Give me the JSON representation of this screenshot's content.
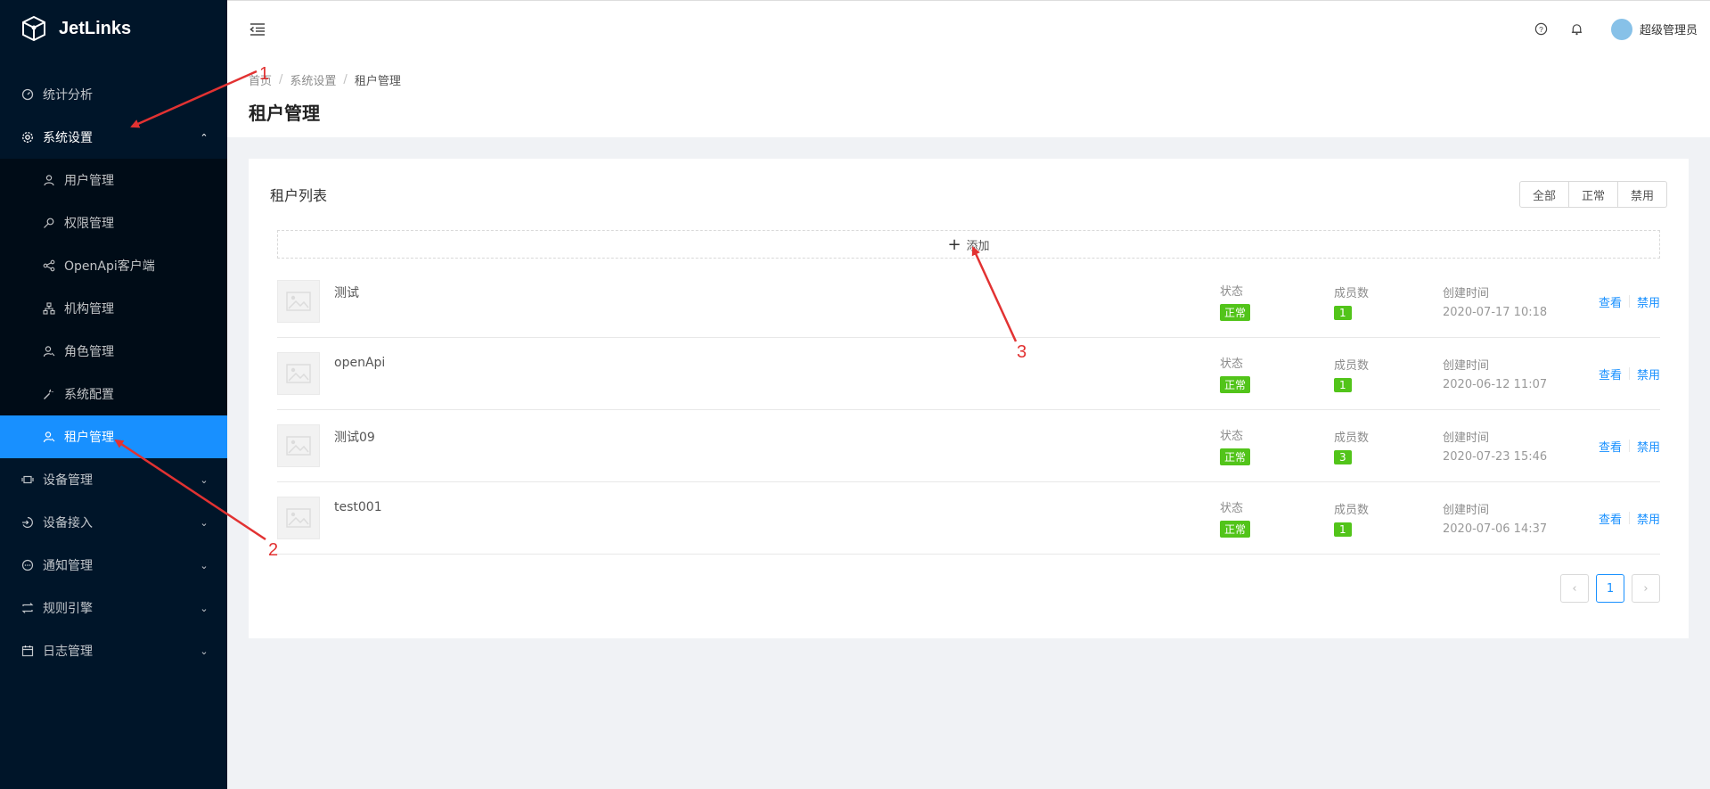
{
  "app": {
    "name": "JetLinks"
  },
  "sidebar": {
    "items": [
      {
        "label": "统计分析",
        "icon": "dashboard-icon"
      },
      {
        "label": "系统设置",
        "icon": "gear-icon",
        "expanded": true,
        "children": [
          {
            "label": "用户管理",
            "icon": "user-icon"
          },
          {
            "label": "权限管理",
            "icon": "key-icon"
          },
          {
            "label": "OpenApi客户端",
            "icon": "share-icon"
          },
          {
            "label": "机构管理",
            "icon": "org-icon"
          },
          {
            "label": "角色管理",
            "icon": "role-icon"
          },
          {
            "label": "系统配置",
            "icon": "wrench-icon"
          },
          {
            "label": "租户管理",
            "icon": "tenant-icon",
            "active": true
          }
        ]
      },
      {
        "label": "设备管理",
        "icon": "device-icon"
      },
      {
        "label": "设备接入",
        "icon": "login-icon"
      },
      {
        "label": "通知管理",
        "icon": "message-icon"
      },
      {
        "label": "规则引擎",
        "icon": "swap-icon"
      },
      {
        "label": "日志管理",
        "icon": "calendar-icon"
      }
    ]
  },
  "header": {
    "user_name": "超级管理员"
  },
  "breadcrumb": [
    "首页",
    "系统设置",
    "租户管理"
  ],
  "page_title": "租户管理",
  "card": {
    "title": "租户列表",
    "filters": [
      "全部",
      "正常",
      "禁用"
    ],
    "add_label": "添加"
  },
  "columns": {
    "status": "状态",
    "members": "成员数",
    "created": "创建时间"
  },
  "tenants": [
    {
      "name": "测试",
      "status": "正常",
      "members": "1",
      "created": "2020-07-17 10:18"
    },
    {
      "name": "openApi",
      "status": "正常",
      "members": "1",
      "created": "2020-06-12 11:07"
    },
    {
      "name": "测试09",
      "status": "正常",
      "members": "3",
      "created": "2020-07-23 15:46"
    },
    {
      "name": "test001",
      "status": "正常",
      "members": "1",
      "created": "2020-07-06 14:37"
    }
  ],
  "actions": {
    "view": "查看",
    "disable": "禁用"
  },
  "pagination": {
    "current": "1"
  },
  "annotations": [
    "1",
    "2",
    "3"
  ],
  "colors": {
    "sidebar_bg": "#001529",
    "submenu_bg": "#000c17",
    "primary": "#1890ff",
    "success": "#52c41a",
    "annotation": "#e23232"
  }
}
